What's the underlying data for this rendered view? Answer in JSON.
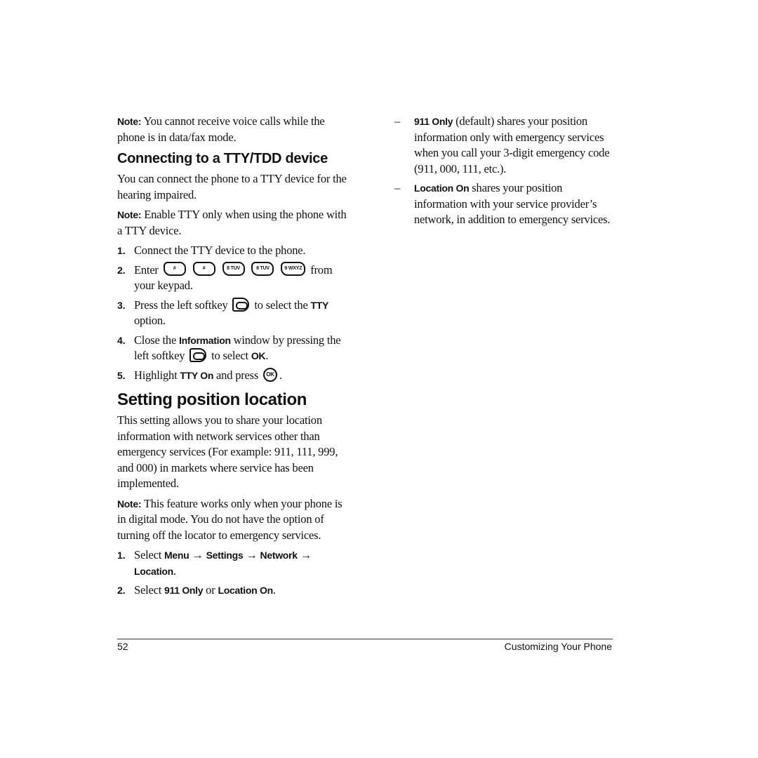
{
  "left_column": {
    "note1": {
      "label": "Note:",
      "text": " You cannot receive voice calls while the phone is in data/fax mode."
    },
    "section1": {
      "heading": "Connecting to a TTY/TDD device",
      "intro": "You can connect the phone to a TTY device for the hearing impaired.",
      "note": {
        "label": "Note:",
        "text": " Enable TTY only when using the phone with a TTY device."
      },
      "steps": [
        {
          "num": "1.",
          "text": "Connect the TTY device to the phone."
        },
        {
          "num": "2.",
          "pre": "Enter",
          "keys": [
            "#",
            "#",
            "8 TUV",
            "8 TUV",
            "9 WXYZ"
          ],
          "post": "from your keypad."
        },
        {
          "num": "3.",
          "pre": "Press the left softkey",
          "post": "to select the",
          "bold": "TTY",
          "tail": " option."
        },
        {
          "num": "4.",
          "pre": "Close the ",
          "bold1": "Information",
          "mid": " window by pressing the left softkey",
          "post": "to select ",
          "bold2": "OK",
          "tail": "."
        },
        {
          "num": "5.",
          "pre": "Highlight ",
          "bold": "TTY On",
          "mid": " and press",
          "icon_label": "OK",
          "tail": "."
        }
      ]
    },
    "section2": {
      "heading": "Setting position location",
      "intro": "This setting allows you to share your location information with network services other than emergency services (For example: 911, 111, 999, and 000) in markets where service has been implemented.",
      "note": {
        "label": "Note:",
        "text": " This feature works only when your phone is in digital mode. You do not have the option of turning off the locator to emergency services."
      },
      "steps": [
        {
          "num": "1.",
          "pre": "Select ",
          "path": [
            "Menu",
            "Settings",
            "Network",
            "Location"
          ],
          "arrow": " → ",
          "tail": "."
        },
        {
          "num": "2.",
          "pre": "Select ",
          "bold1": "911 Only",
          "mid": " or ",
          "bold2": "Location On",
          "tail": "."
        }
      ]
    }
  },
  "right_column": {
    "options": [
      {
        "dash": "–",
        "bold": "911 Only",
        "text": " (default) shares your position information only with emergency services when you call your 3-digit emergency code (911, 000, 111, etc.)."
      },
      {
        "dash": "–",
        "bold": "Location On",
        "text": " shares your position information with your service provider’s network, in addition to emergency services."
      }
    ]
  },
  "footer": {
    "page_number": "52",
    "chapter_title": "Customizing Your Phone"
  }
}
